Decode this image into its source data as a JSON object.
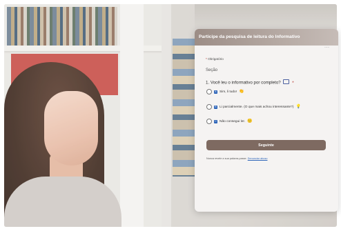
{
  "form": {
    "title": "Participe da pesquisa de leitura do Informativo",
    "more_icon": "more-dots-icon",
    "required_note": "Obrigatório",
    "section_label": "Seção",
    "question": {
      "number": "1.",
      "text": "Você leu o informativo por completo?",
      "required_marker": "*",
      "icon": "immersive-reader-icon"
    },
    "options": [
      {
        "index": "A",
        "label": "Sim, li tudo!",
        "emoji": "👏"
      },
      {
        "index": "B",
        "label": "Li parcialmente. (O que mais achou interessante?)",
        "emoji": "💡"
      },
      {
        "index": "C",
        "label": "Não consegui ler.",
        "emoji": "🙁"
      }
    ],
    "next_button": "Seguinte",
    "footer_text": "Nunca revele a sua palavra-passe.",
    "footer_link": "Denunciar abuso"
  },
  "colors": {
    "header": "#9c8d86",
    "button": "#7e6a61",
    "panel": "#f5f3f2",
    "accent_blue": "#2b63b8",
    "required_red": "#b3261e"
  }
}
